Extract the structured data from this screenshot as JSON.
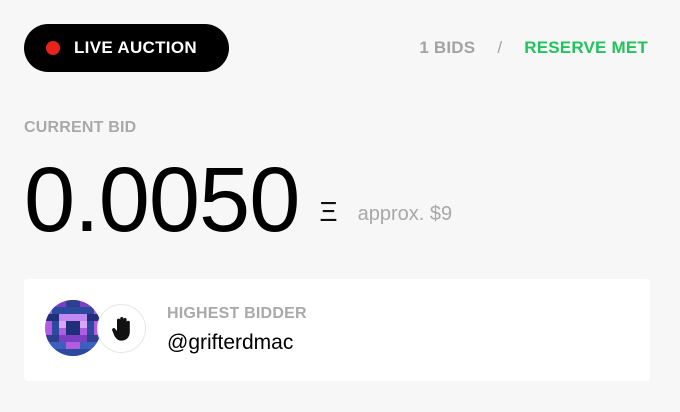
{
  "auction": {
    "live_label": "LIVE AUCTION",
    "bids_count": "1 BIDS",
    "separator": "/",
    "reserve_status": "RESERVE MET"
  },
  "bid": {
    "label": "CURRENT BID",
    "amount": "0.0050",
    "currency_symbol": "Ξ",
    "approx": "approx. $9"
  },
  "bidder": {
    "label": "HIGHEST BIDDER",
    "handle": "@grifterdmac",
    "avatar_icon": "pixel-avatar",
    "badge_icon": "raised-hand-icon"
  },
  "colors": {
    "live_dot": "#e8231a",
    "reserve_met": "#21c45c",
    "muted": "#a9a9a9"
  }
}
